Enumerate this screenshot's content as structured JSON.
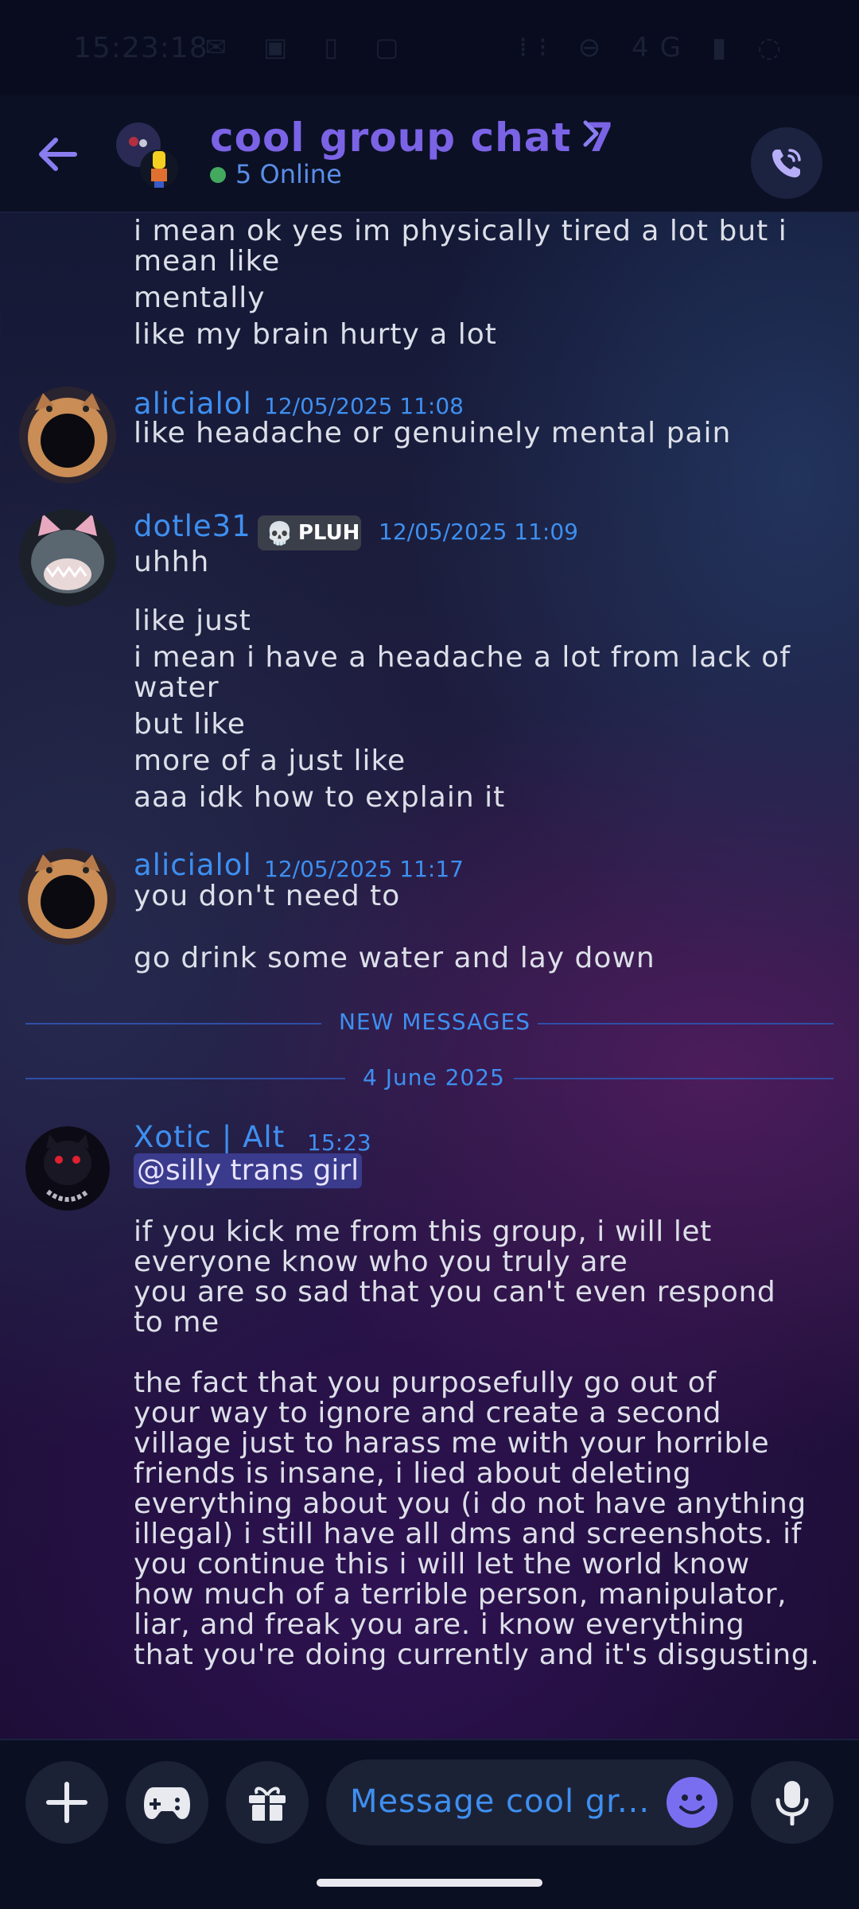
{
  "status_bar": {
    "time": "15:23:18",
    "network": "4G"
  },
  "header": {
    "title": "cool group chat 7",
    "online": "5 Online"
  },
  "messages": {
    "cont_lines": [
      "i mean ok yes im physically tired a lot but i\nmean like",
      "mentally",
      "like my brain hurty a lot"
    ],
    "m1": {
      "author": "alicialol",
      "time": "12/05/2025 11:08",
      "text": "like headache or genuinely mental pain"
    },
    "m2": {
      "author": "dotle31",
      "badge": "PLUH",
      "time": "12/05/2025 11:09",
      "lines": [
        "uhhh",
        "like just",
        "i mean i have a headache a lot from lack of\nwater",
        "but like",
        "more of a just like",
        "aaa idk how to explain it"
      ]
    },
    "m3": {
      "author": "alicialol",
      "time": "12/05/2025 11:17",
      "lines": [
        "you don't need to",
        "go drink some water and lay down"
      ]
    },
    "new_messages_label": "NEW MESSAGES",
    "date_label": "4 June 2025",
    "m4": {
      "author": "Xotic | Alt",
      "time": "15:23",
      "mention": "@silly trans girl",
      "body": "if you kick me from this group, i will let\neveryone know who you truly are\nyou are so sad that you can't even respond\nto me\n\nthe fact that you purposefully go out of\nyour way to ignore and create a second\nvillage just to harass me with your horrible\nfriends is insane, i lied about deleting\neverything about you (i do not have anything\nillegal) i still have all dms and screenshots. if\nyou continue this i will let the world know\nhow much of a terrible person, manipulator,\nliar, and freak you are. i know everything\nthat you're doing currently and it's disgusting."
    }
  },
  "composer": {
    "placeholder": "Message cool gr..."
  },
  "colors": {
    "accent": "#7b63e6",
    "link_blue": "#3e8ff0",
    "online": "#43a95f"
  }
}
